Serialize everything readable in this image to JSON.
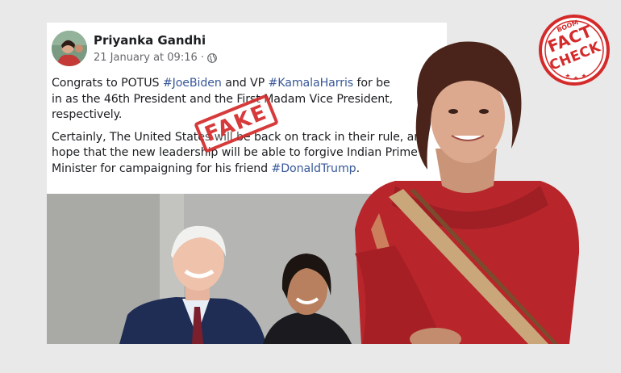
{
  "post": {
    "author": "Priyanka Gandhi",
    "timestamp": "21 January at 09:16 ·",
    "privacy_icon": "globe-icon",
    "paragraphs": [
      {
        "segments": [
          {
            "text": "Congrats to POTUS ",
            "type": "text"
          },
          {
            "text": "#JoeBiden",
            "type": "hashtag"
          },
          {
            "text": " and VP ",
            "type": "text"
          },
          {
            "text": "#KamalaHarris",
            "type": "hashtag"
          },
          {
            "text": " for be",
            "type": "text"
          }
        ],
        "lines_after": [
          "in as the 46th President and the First Madam Vice President,",
          "respectively."
        ]
      }
    ],
    "para2_line1": "Certainly, The United States will be back on track in their rule, and",
    "para2_line2": "hope that the new leadership will be able to forgive Indian Prime",
    "para2_line3_prefix": "Minister for campaigning for his friend ",
    "para2_line3_tag": "#DonaldTrump",
    "para2_line3_suffix": "."
  },
  "stamp": {
    "label": "FAKE",
    "color": "#d42a2a"
  },
  "badge": {
    "brand": "BOOM",
    "line1": "FACT",
    "line2": "CHECK",
    "color": "#d42a2a"
  },
  "colors": {
    "hashtag": "#385898",
    "saree": "#c0272d",
    "border": "#c9a77a"
  }
}
